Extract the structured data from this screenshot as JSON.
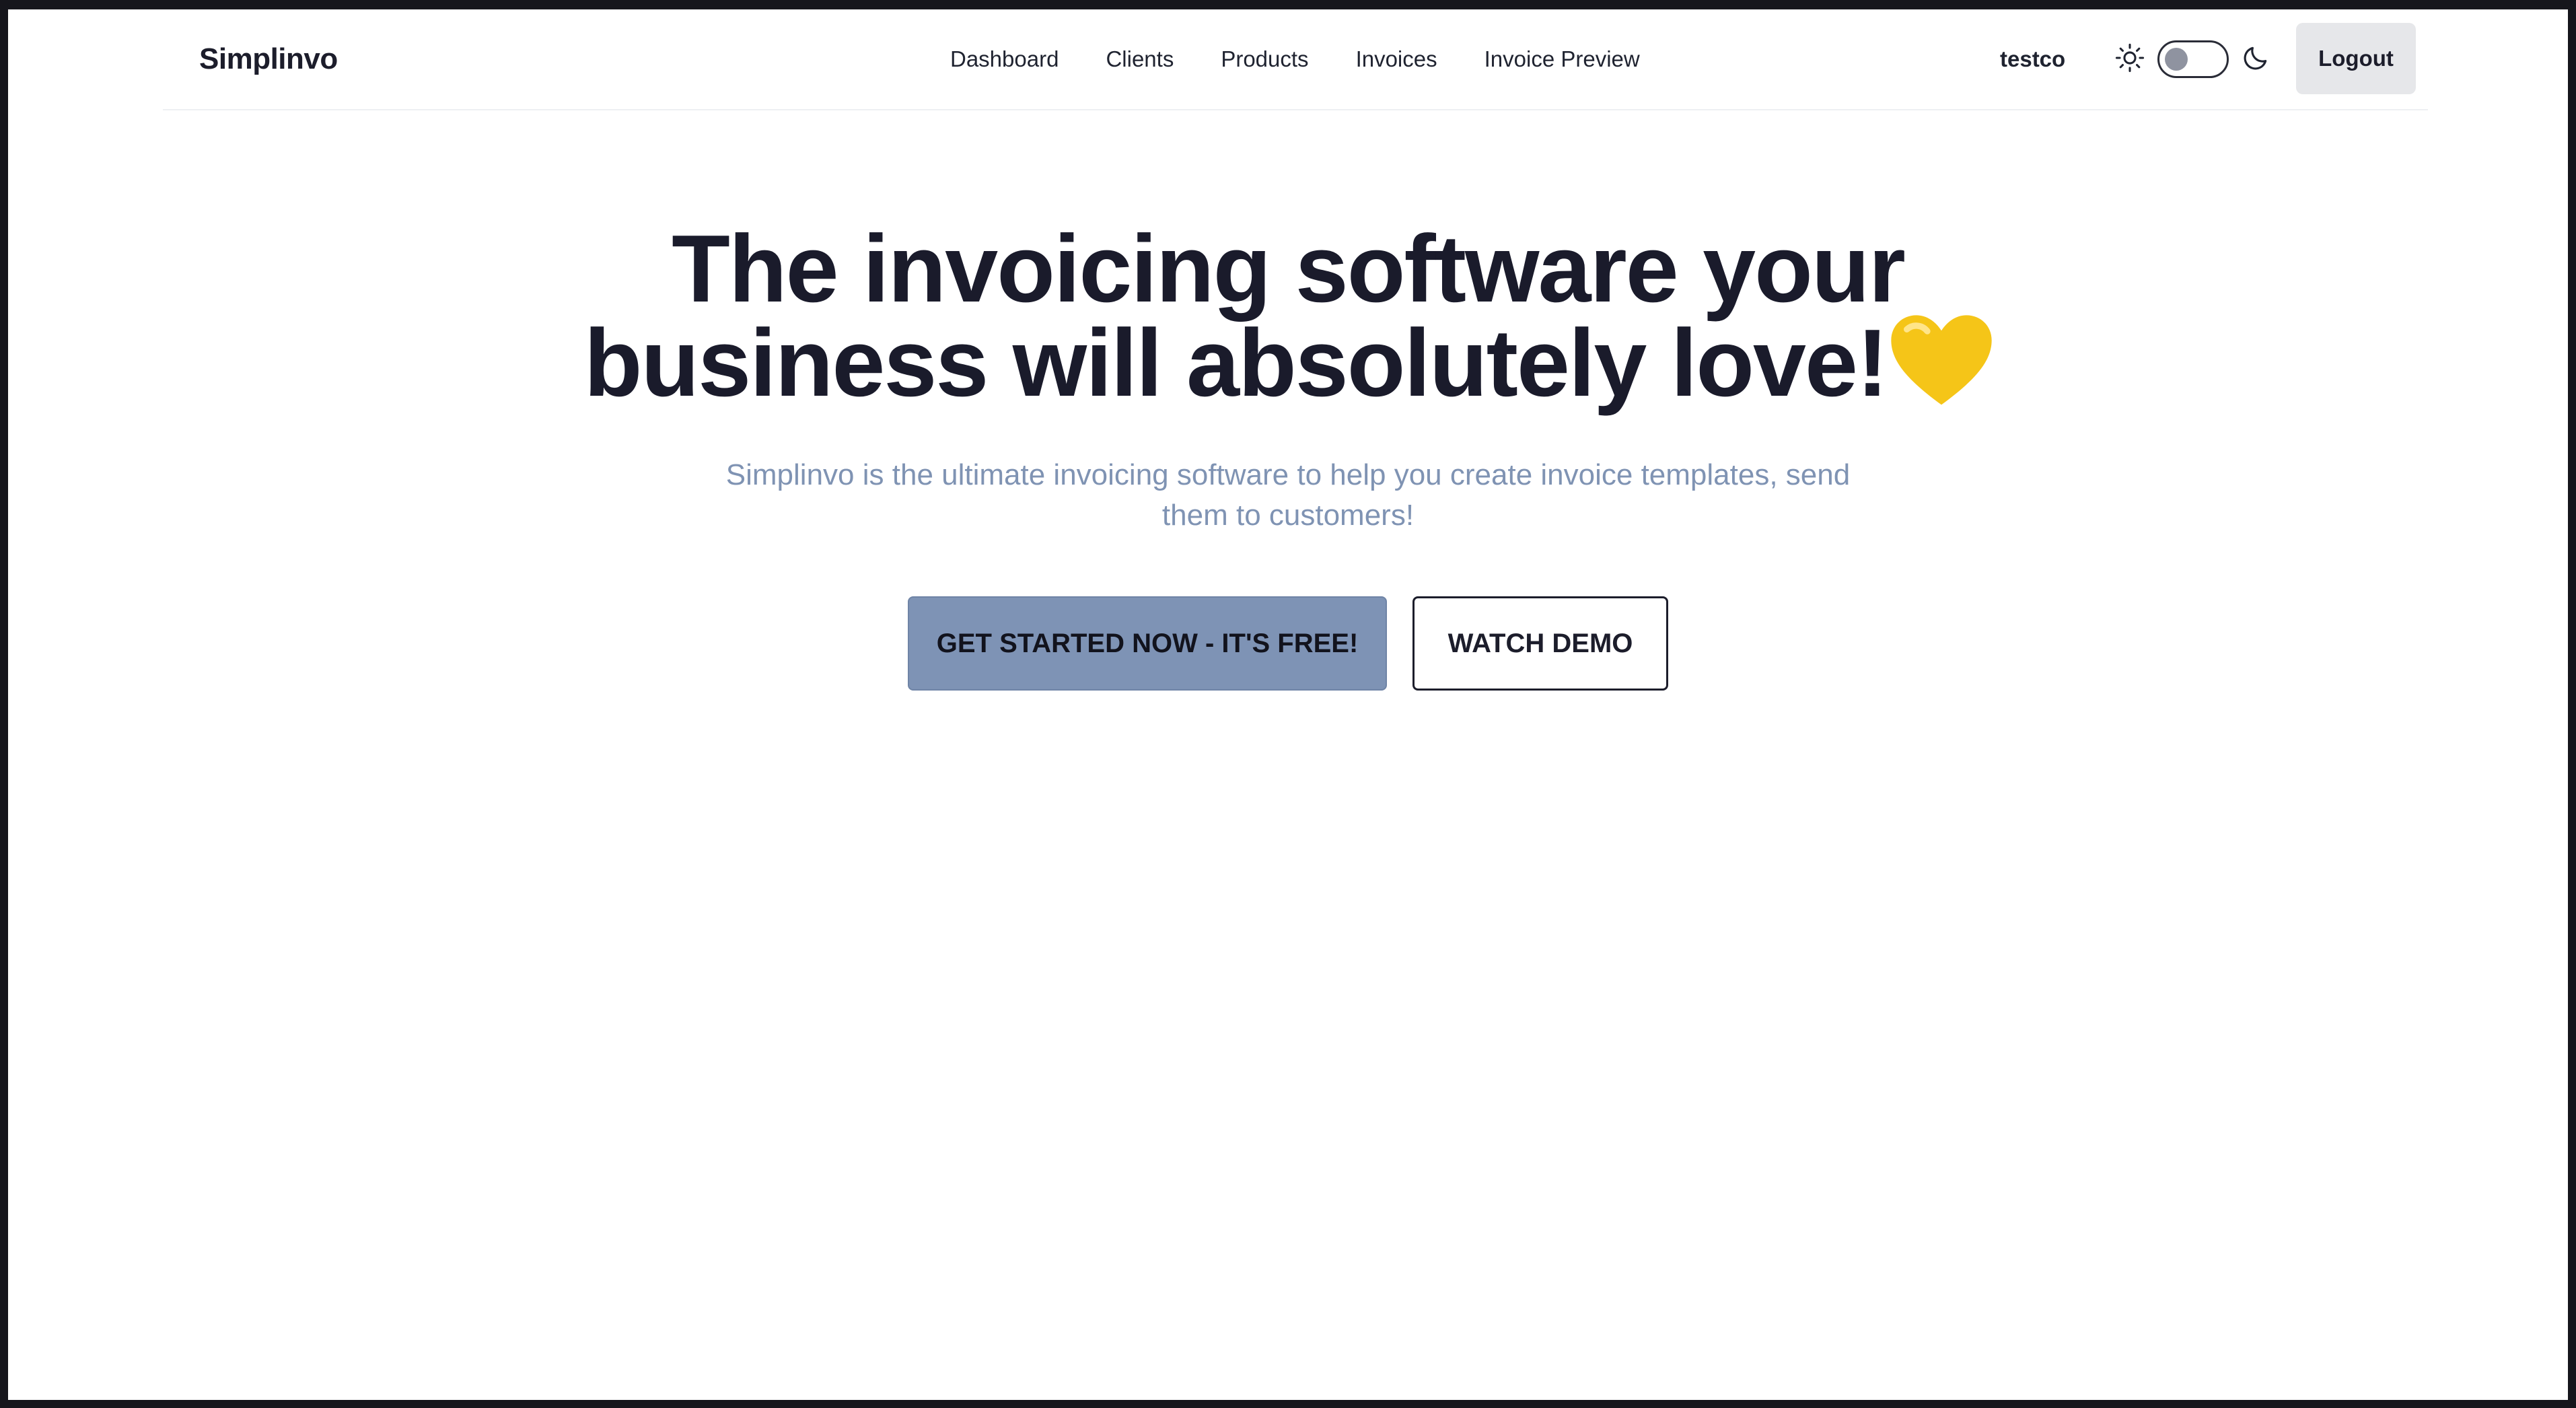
{
  "header": {
    "brand": "Simplinvo",
    "nav": [
      "Dashboard",
      "Clients",
      "Products",
      "Invoices",
      "Invoice Preview"
    ],
    "user": "testco",
    "theme_toggle": {
      "state": "light",
      "icons": [
        "sun-icon",
        "moon-icon"
      ]
    },
    "logout_label": "Logout"
  },
  "hero": {
    "title_line1": "The invoicing software your",
    "title_line2": "business will absolutely love!",
    "title_emoji": "yellow-heart-icon",
    "subtitle": "Simplinvo is the ultimate invoicing software to help you create invoice templates, send them to customers!",
    "primary_cta": "GET STARTED NOW - IT'S FREE!",
    "secondary_cta": "WATCH DEMO"
  },
  "colors": {
    "primary_button": "#7e93b5",
    "subtitle": "#7f93b3",
    "title": "#1a1b2b",
    "heart": "#f5c518",
    "frame": "#16161c"
  }
}
